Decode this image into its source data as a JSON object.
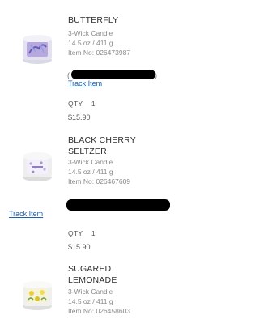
{
  "items": [
    {
      "name": "BUTTERFLY",
      "type": "3-Wick Candle",
      "size": "14.5 oz / 411 g",
      "item_no": "Item No: 026473987",
      "track_label": "Track Item",
      "qty_label": "QTY",
      "qty": "1",
      "price": "$15.90",
      "image": "butterfly-candle-image"
    },
    {
      "name": "BLACK CHERRY SELTZER",
      "type": "3-Wick Candle",
      "size": "14.5 oz / 411 g",
      "item_no": "Item No: 026467609",
      "track_label": "Track Item",
      "qty_label": "QTY",
      "qty": "1",
      "price": "$15.90",
      "image": "black-cherry-seltzer-candle-image"
    },
    {
      "name": "SUGARED LEMONADE",
      "type": "3-Wick Candle",
      "size": "14.5 oz / 411 g",
      "item_no": "Item No: 026458603",
      "image": "sugared-lemonade-candle-image"
    }
  ],
  "colors": {
    "link": "#1f5fa8",
    "text": "#3d3d3d",
    "muted": "#8a8a8a"
  }
}
